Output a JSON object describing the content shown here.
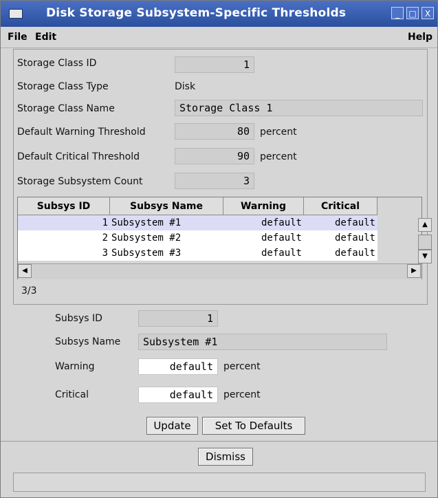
{
  "window": {
    "title": "Disk Storage Subsystem-Specific Thresholds",
    "buttons": [
      "_",
      "□",
      "X"
    ]
  },
  "menu": {
    "file": "File",
    "edit": "Edit",
    "help": "Help"
  },
  "storage": {
    "class_id_label": "Storage Class ID",
    "class_id": "1",
    "class_type_label": "Storage Class Type",
    "class_type": "Disk",
    "class_name_label": "Storage Class Name",
    "class_name": "Storage Class 1",
    "default_warning_label": "Default Warning Threshold",
    "default_warning": "80",
    "default_critical_label": "Default Critical Threshold",
    "default_critical": "90",
    "subsystem_count_label": "Storage Subsystem Count",
    "subsystem_count": "3",
    "unit": "percent"
  },
  "table": {
    "columns": [
      "Subsys ID",
      "Subsys Name",
      "Warning",
      "Critical"
    ],
    "rows": [
      {
        "id": "1",
        "name": "Subsystem #1",
        "warning": "default",
        "critical": "default"
      },
      {
        "id": "2",
        "name": "Subsystem #2",
        "warning": "default",
        "critical": "default"
      },
      {
        "id": "3",
        "name": "Subsystem #3",
        "warning": "default",
        "critical": "default"
      }
    ],
    "count": "3/3"
  },
  "detail": {
    "id_label": "Subsys ID",
    "id": "1",
    "name_label": "Subsys Name",
    "name": "Subsystem #1",
    "warning_label": "Warning",
    "warning": "default",
    "critical_label": "Critical",
    "critical": "default",
    "unit": "percent"
  },
  "actions": {
    "update": "Update",
    "set_defaults": "Set To Defaults",
    "dismiss": "Dismiss"
  },
  "colors": {
    "titlebar": "#2a4f9e",
    "selected_row": "#dcdcf6",
    "window_bg": "#d6d6d6"
  }
}
